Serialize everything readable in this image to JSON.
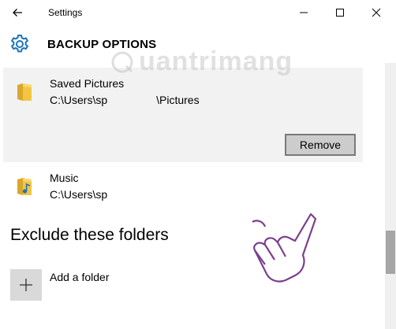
{
  "window": {
    "title": "Settings",
    "back_label": "Back",
    "minimize_label": "Minimize",
    "maximize_label": "Maximize",
    "close_label": "Close"
  },
  "header": {
    "title": "BACKUP OPTIONS",
    "icon": "gear-icon"
  },
  "watermark": {
    "text": "uantrimang"
  },
  "folders": [
    {
      "name": "Saved Pictures",
      "path_prefix": "C:\\Users\\sp",
      "path_suffix": "\\Pictures",
      "icon": "folder-icon",
      "selected": true
    },
    {
      "name": "Music",
      "path_prefix": "C:\\Users\\sp",
      "path_suffix": "",
      "icon": "music-folder-icon",
      "selected": false
    }
  ],
  "remove_button": {
    "label": "Remove"
  },
  "exclude_section": {
    "heading": "Exclude these folders",
    "add_label": "Add a folder"
  },
  "colors": {
    "selected_row_bg": "#f2f2f2",
    "button_bg": "#cccccc",
    "folder_yellow": "#f4c542",
    "accent_blue": "#1c75bc",
    "hand_purple": "#7b3f8c"
  }
}
